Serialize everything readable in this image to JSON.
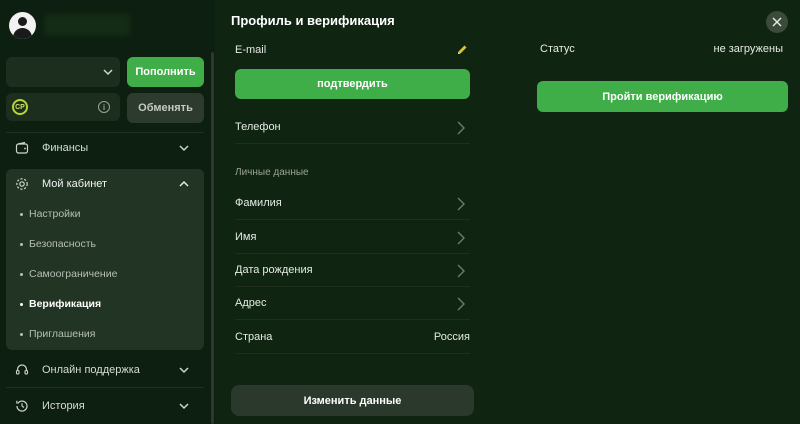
{
  "sidebar": {
    "topup_label": "Пополнить",
    "cp_badge": "CP",
    "info_icon_glyph": "i",
    "exchange_label": "Обменять",
    "nav": {
      "finance": "Финансы",
      "cabinet": "Мой кабинет",
      "support": "Онлайн поддержка",
      "history": "История"
    },
    "cabinet_items": [
      "Настройки",
      "Безопасность",
      "Самоограничение",
      "Верификация",
      "Приглашения"
    ],
    "active_item": "Верификация"
  },
  "main": {
    "title": "Профиль и верификация",
    "email_label": "E-mail",
    "confirm_label": "подтвердить",
    "phone_label": "Телефон",
    "personal_section": "Личные данные",
    "fields": {
      "surname": "Фамилия",
      "name": "Имя",
      "birthdate": "Дата рождения",
      "address": "Адрес",
      "country": "Страна",
      "country_value": "Россия"
    },
    "edit_label": "Изменить данные",
    "status_label": "Статус",
    "status_value": "не загружены",
    "verify_label": "Пройти верификацию"
  },
  "colors": {
    "accent": "#3fae48",
    "background": "#0f2411",
    "sidebar_bg": "#0d1f10",
    "cp_badge": "#b9d434"
  }
}
